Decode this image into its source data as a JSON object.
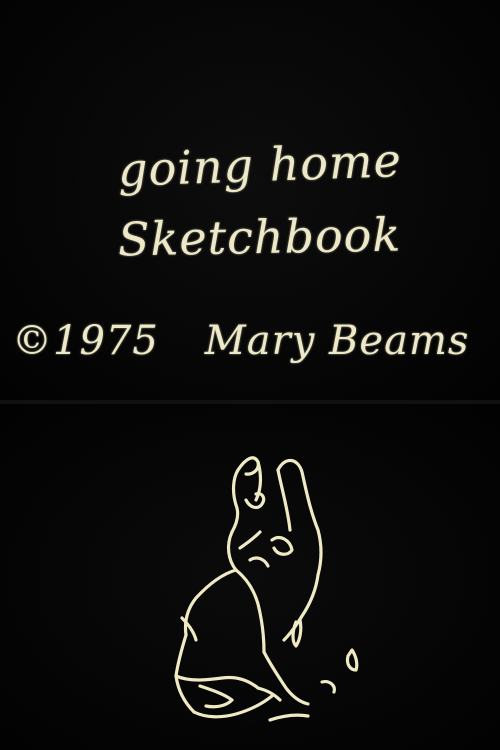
{
  "title": {
    "line1": "going home",
    "line2": "Sketchbook"
  },
  "credit": {
    "copyright": "©1975",
    "author": "Mary Beams"
  },
  "colors": {
    "background": "#000000",
    "chalk": "#ece8c8"
  }
}
